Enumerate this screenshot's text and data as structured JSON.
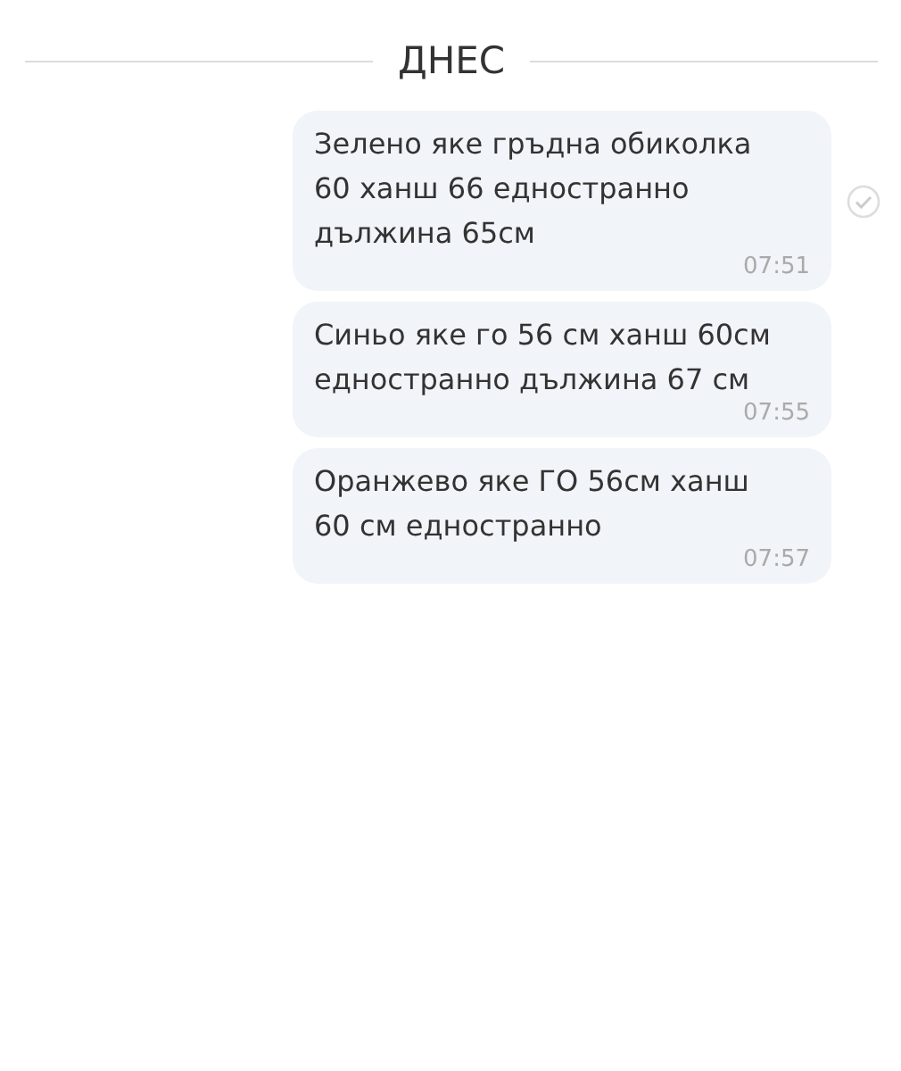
{
  "date_divider": "ДНЕС",
  "messages": [
    {
      "lines": [
        "Зелено яке гръдна обиколка",
        "60 ханш 66 едностранно",
        "дължина 65см"
      ],
      "time": "07:51",
      "read": true
    },
    {
      "lines": [
        "Синьо яке го 56 см ханш 60см",
        "едностранно дължина 67 см"
      ],
      "time": "07:55",
      "read": false
    },
    {
      "lines": [
        "Оранжево яке ГО 56см ханш",
        "60 см едностранно"
      ],
      "time": "07:57",
      "read": false
    }
  ]
}
